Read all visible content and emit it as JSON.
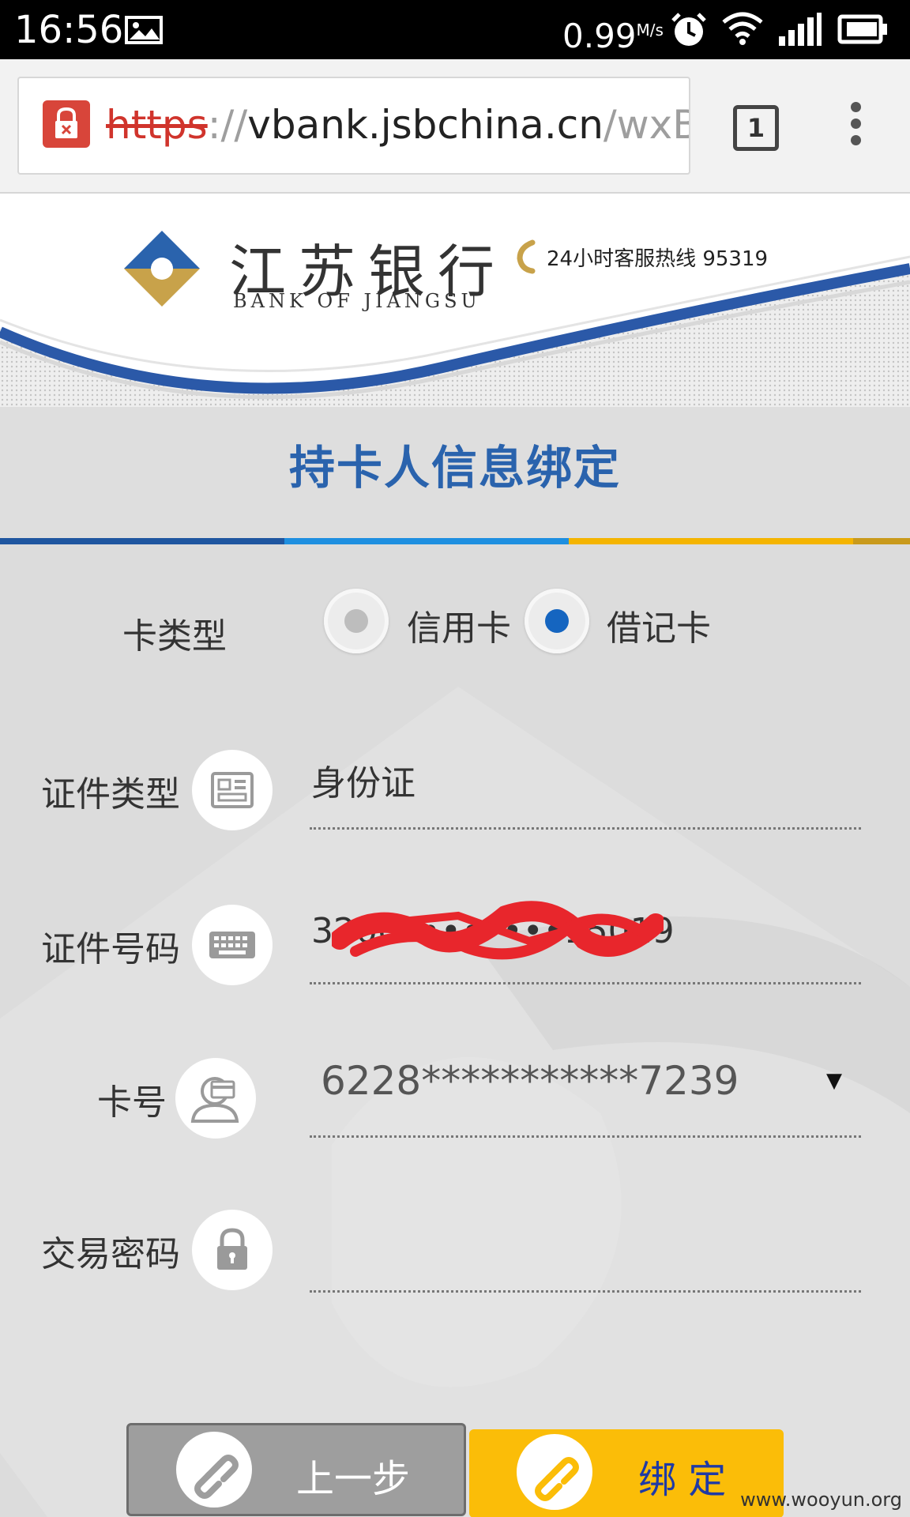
{
  "status_bar": {
    "time": "16:56",
    "network_speed": "0.99",
    "network_speed_unit": "M/s",
    "icons": [
      "image-icon",
      "alarm-icon",
      "wifi-icon",
      "signal-icon",
      "battery-icon"
    ]
  },
  "browser": {
    "url_scheme": "https",
    "url_separator": "://",
    "url_host": "vbank.jsbchina.cn",
    "url_path": "/wxBa",
    "tab_count": "1",
    "security_state": "insecure"
  },
  "header": {
    "bank_name_cn": "江苏银行",
    "bank_name_en": "BANK OF JIANGSU",
    "hotline": "24小时客服热线  95319"
  },
  "page": {
    "title": "持卡人信息绑定"
  },
  "form": {
    "card_type": {
      "label": "卡类型",
      "options": [
        {
          "label": "信用卡",
          "selected": false
        },
        {
          "label": "借记卡",
          "selected": true
        }
      ]
    },
    "id_type": {
      "label": "证件类型",
      "value": "身份证"
    },
    "id_number": {
      "label": "证件号码",
      "value": "3200••••••••15019",
      "redacted": true
    },
    "card_number": {
      "label": "卡号",
      "value": "6228***********7239",
      "dropdown_arrow": "▼"
    },
    "trade_password": {
      "label": "交易密码",
      "value": ""
    }
  },
  "buttons": {
    "prev": "上一步",
    "bind": "绑  定"
  },
  "watermark": "www.wooyun.org",
  "colors": {
    "title_blue": "#2a63ad",
    "bind_button_yellow": "#fbbd08",
    "prev_button_gray": "#9e9e9e",
    "radio_selected": "#1565c0",
    "lock_red": "#d8453a"
  }
}
